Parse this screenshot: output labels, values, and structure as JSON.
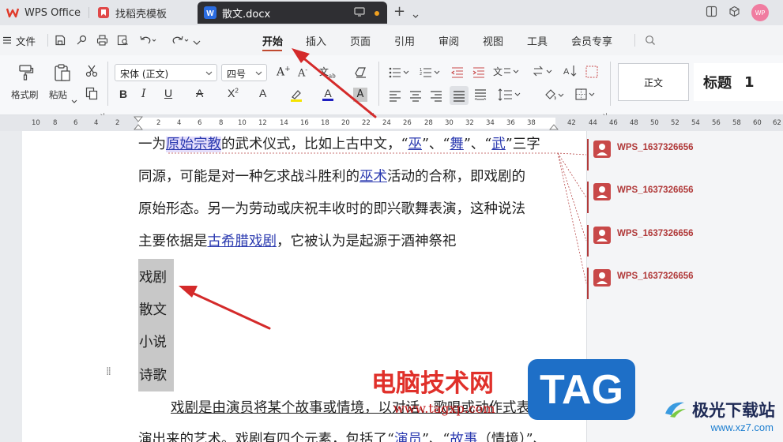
{
  "titlebar": {
    "tabs": [
      {
        "label": "WPS Office"
      },
      {
        "label": "找稻壳模板"
      },
      {
        "label": "散文.docx"
      }
    ],
    "avatar_text": "WP"
  },
  "menu": {
    "file_label": "文件",
    "items": [
      "开始",
      "插入",
      "页面",
      "引用",
      "审阅",
      "视图",
      "工具",
      "会员专享"
    ],
    "active": "开始"
  },
  "ribbon": {
    "format_painter_label": "格式刷",
    "paste_label": "粘贴",
    "font_name": "宋体 (正文)",
    "font_size": "四号",
    "style_normal": "正文",
    "style_heading1": "标题",
    "style_heading1_num": "1"
  },
  "ruler": {
    "labels": [
      "10",
      "8",
      "6",
      "4",
      "2",
      "2",
      "4",
      "6",
      "8",
      "10",
      "12",
      "14",
      "16",
      "18",
      "20",
      "22",
      "24",
      "26",
      "28",
      "30",
      "32",
      "34",
      "36",
      "38",
      "42",
      "44",
      "46",
      "48",
      "50",
      "52",
      "54",
      "56",
      "58",
      "60",
      "62"
    ]
  },
  "document": {
    "line1_a": "一为",
    "line1_link": "原始宗教",
    "line1_b": "的武术仪式，比如上古中文，“",
    "line1_l2": "巫",
    "line1_c": "”、“",
    "line1_l3": "舞",
    "line1_d": "”、“",
    "line1_l4": "武",
    "line1_e": "”三字",
    "line2_a": "同源，可能是对一种乞求战斗胜利的",
    "line2_link": "巫术",
    "line2_b": "活动的合称，即戏剧的",
    "line3": "原始形态。另一为劳动或庆祝丰收时的即兴歌舞表演，这种说法",
    "line4_a": "主要依据是",
    "line4_link": "古希腊戏剧",
    "line4_b": "，它被认为是起源于酒神祭祀",
    "selected_lines": [
      "戏剧",
      "散文",
      "小说",
      "诗歌"
    ],
    "line5": "戏剧是由演员将某个故事或情境，以对话、歌唱或动作式表",
    "line6_a": "演出来的艺术。戏剧有四个元素，包括了“",
    "line6_l1": "演员",
    "line6_b": "”、“",
    "line6_l2": "故事",
    "line6_c": "（情境）”、"
  },
  "comments": [
    {
      "author": "WPS_1637326656"
    },
    {
      "author": "WPS_1637326656"
    },
    {
      "author": "WPS_1637326656"
    },
    {
      "author": "WPS_1637326656"
    }
  ],
  "watermark": {
    "site_cn": "电脑技术网",
    "site_url": "www.tagxp.com",
    "badge": "TAG",
    "logo_name": "极光下载站",
    "logo_url": "www.xz7.com"
  },
  "colors": {
    "accent_red": "#c04a30",
    "annotation_arrow": "#d42a2a",
    "link_blue": "#2c3bb0",
    "comment_red": "#b03838"
  }
}
